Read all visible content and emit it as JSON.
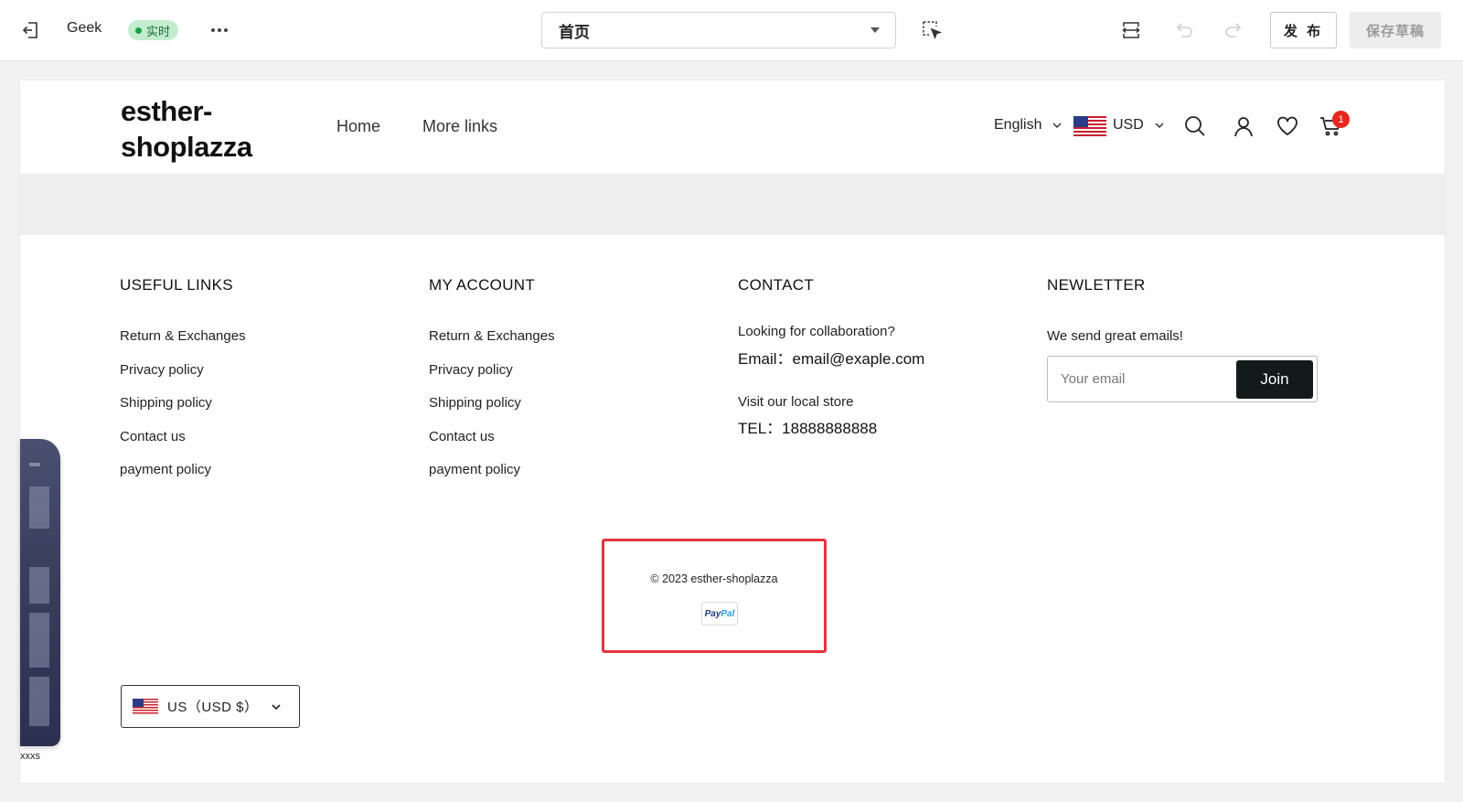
{
  "toolbar": {
    "site_name": "Geek",
    "status_badge": "实时",
    "page_select": "首页",
    "publish_label": "发 布",
    "save_draft_label": "保存草稿",
    "icons": [
      "exit-icon",
      "more-icon",
      "chevron-down-icon",
      "select-element-icon",
      "fit-width-icon",
      "undo-icon",
      "redo-icon"
    ]
  },
  "store": {
    "logo": [
      "esther-",
      "shoplazza"
    ],
    "nav": [
      "Home",
      "More links"
    ],
    "language": "English",
    "currency": "USD",
    "cart_count": "1",
    "header_icons": [
      "search-icon",
      "user-icon",
      "heart-icon",
      "cart-icon",
      "us-flag-icon"
    ]
  },
  "footer": {
    "useful_links": {
      "title": "USEFUL LINKS",
      "links": [
        "Return & Exchanges",
        "Privacy policy",
        "Shipping policy",
        "Contact us",
        "payment policy"
      ]
    },
    "my_account": {
      "title": "MY ACCOUNT",
      "links": [
        "Return & Exchanges",
        "Privacy policy",
        "Shipping policy",
        "Contact us",
        "payment policy"
      ]
    },
    "contact": {
      "title": "CONTACT",
      "collab_label": "Looking for collaboration?",
      "email": "Email：email@exaple.com",
      "store_label": "Visit our local store",
      "tel": "TEL：18888888888"
    },
    "newsletter": {
      "title": "NEWLETTER",
      "subtitle": "We send great emails!",
      "placeholder": "Your email",
      "join_label": "Join"
    },
    "copyright": "© 2023 esther-shoplazza",
    "payment": {
      "pp1": "Pay",
      "pp2": "Pal"
    },
    "region": "US（USD $）"
  },
  "phone_preview": {
    "label": "xxxs"
  },
  "colors": {
    "accent_badge_bg": "#c4ecd0",
    "cart_badge": "#e7291d",
    "highlight_border": "#e2363c",
    "join_button": "#121a1a"
  }
}
